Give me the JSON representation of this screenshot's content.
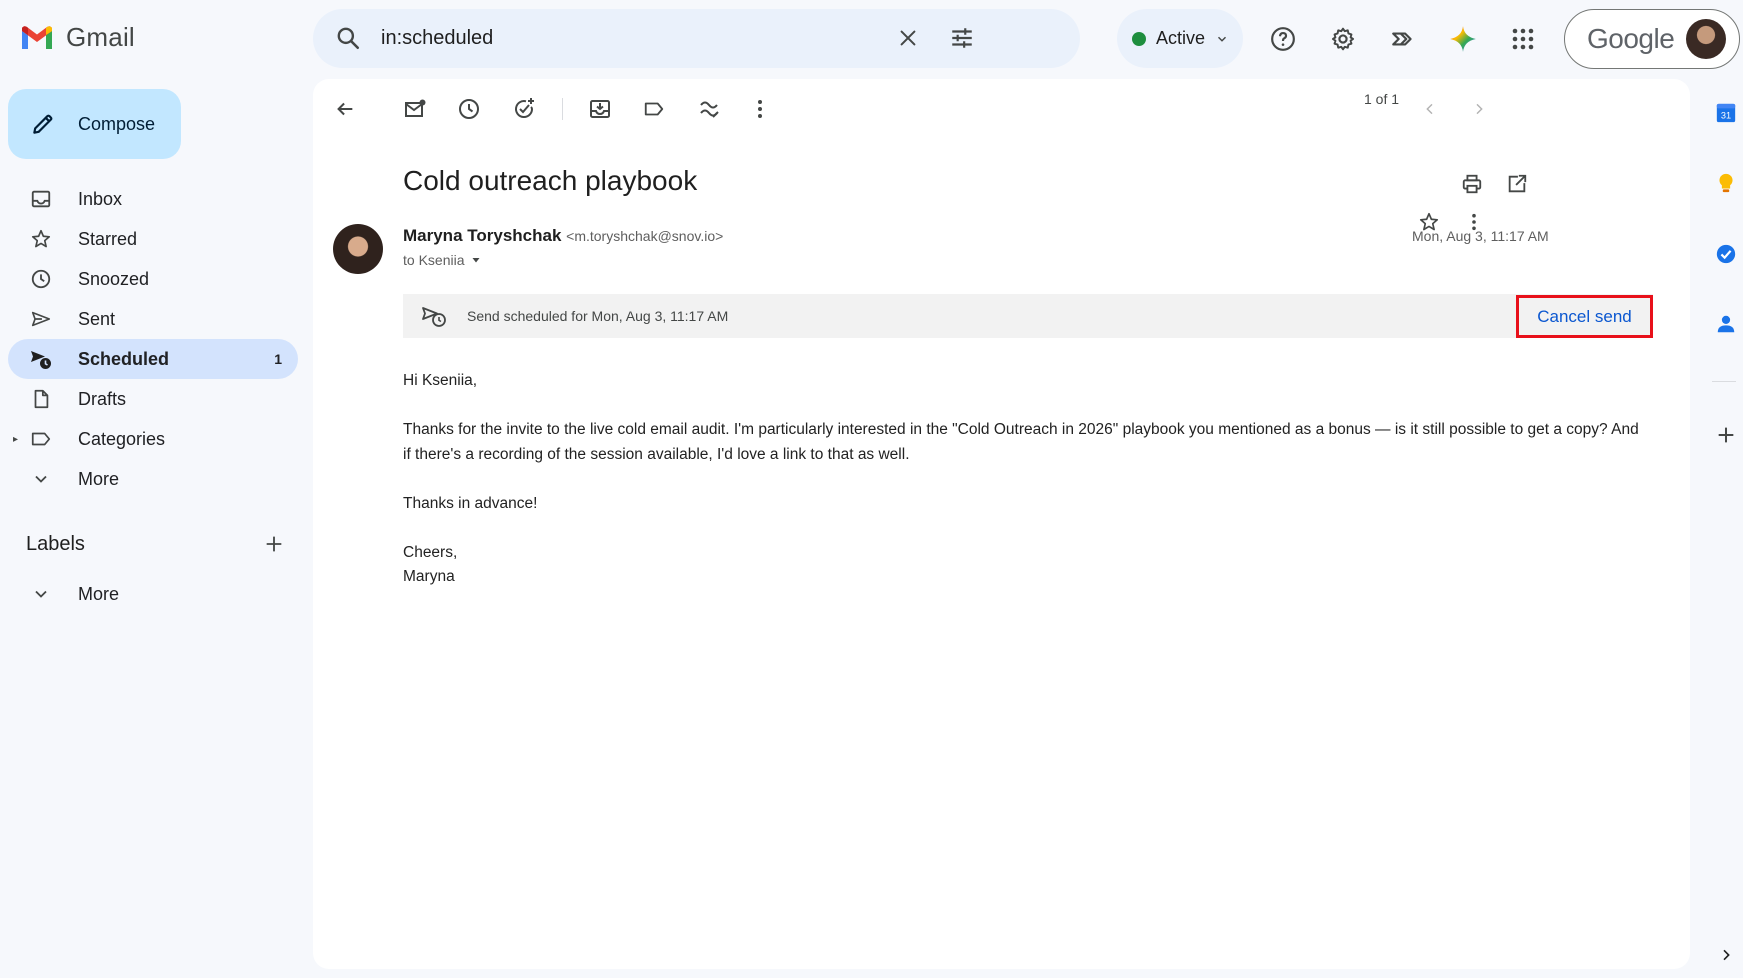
{
  "app": {
    "name": "Gmail"
  },
  "search": {
    "query": "in:scheduled"
  },
  "header": {
    "status": "Active",
    "account_brand": "Google"
  },
  "compose": {
    "label": "Compose"
  },
  "sidebar": {
    "items": [
      {
        "label": "Inbox",
        "icon": "inbox-icon"
      },
      {
        "label": "Starred",
        "icon": "star-icon"
      },
      {
        "label": "Snoozed",
        "icon": "clock-icon"
      },
      {
        "label": "Sent",
        "icon": "send-icon"
      },
      {
        "label": "Scheduled",
        "icon": "scheduled-icon",
        "count": "1",
        "selected": true
      },
      {
        "label": "Drafts",
        "icon": "draft-icon"
      },
      {
        "label": "Categories",
        "icon": "label-icon"
      },
      {
        "label": "More",
        "icon": "chevron-down-icon"
      }
    ],
    "labels_title": "Labels",
    "labels_more": "More"
  },
  "toolbar": {
    "pager": "1 of 1"
  },
  "email": {
    "subject": "Cold outreach playbook",
    "sender_name": "Maryna Toryshchak",
    "sender_email": "<m.toryshchak@snov.io>",
    "to": "to Kseniia",
    "date": "Mon, Aug 3, 11:17 AM",
    "schedule_notice": "Send scheduled for Mon, Aug 3, 11:17 AM",
    "cancel_label": "Cancel send",
    "body": [
      "Hi Kseniia,",
      "Thanks for the invite to the live cold email audit. I'm particularly interested in the \"Cold Outreach in 2026\" playbook you mentioned as a bonus — is it still possible to get a copy? And if there's a recording of the session available, I'd love a link to that as well.",
      "Thanks in advance!"
    ],
    "signoff": "Cheers,",
    "signature": "Maryna"
  },
  "rail": {
    "calendar_day": "31"
  },
  "colors": {
    "accent": "#0b57d0",
    "selected_nav": "#d3e3fd",
    "compose_bg": "#c2e7ff",
    "highlight_border": "#e8101a"
  }
}
